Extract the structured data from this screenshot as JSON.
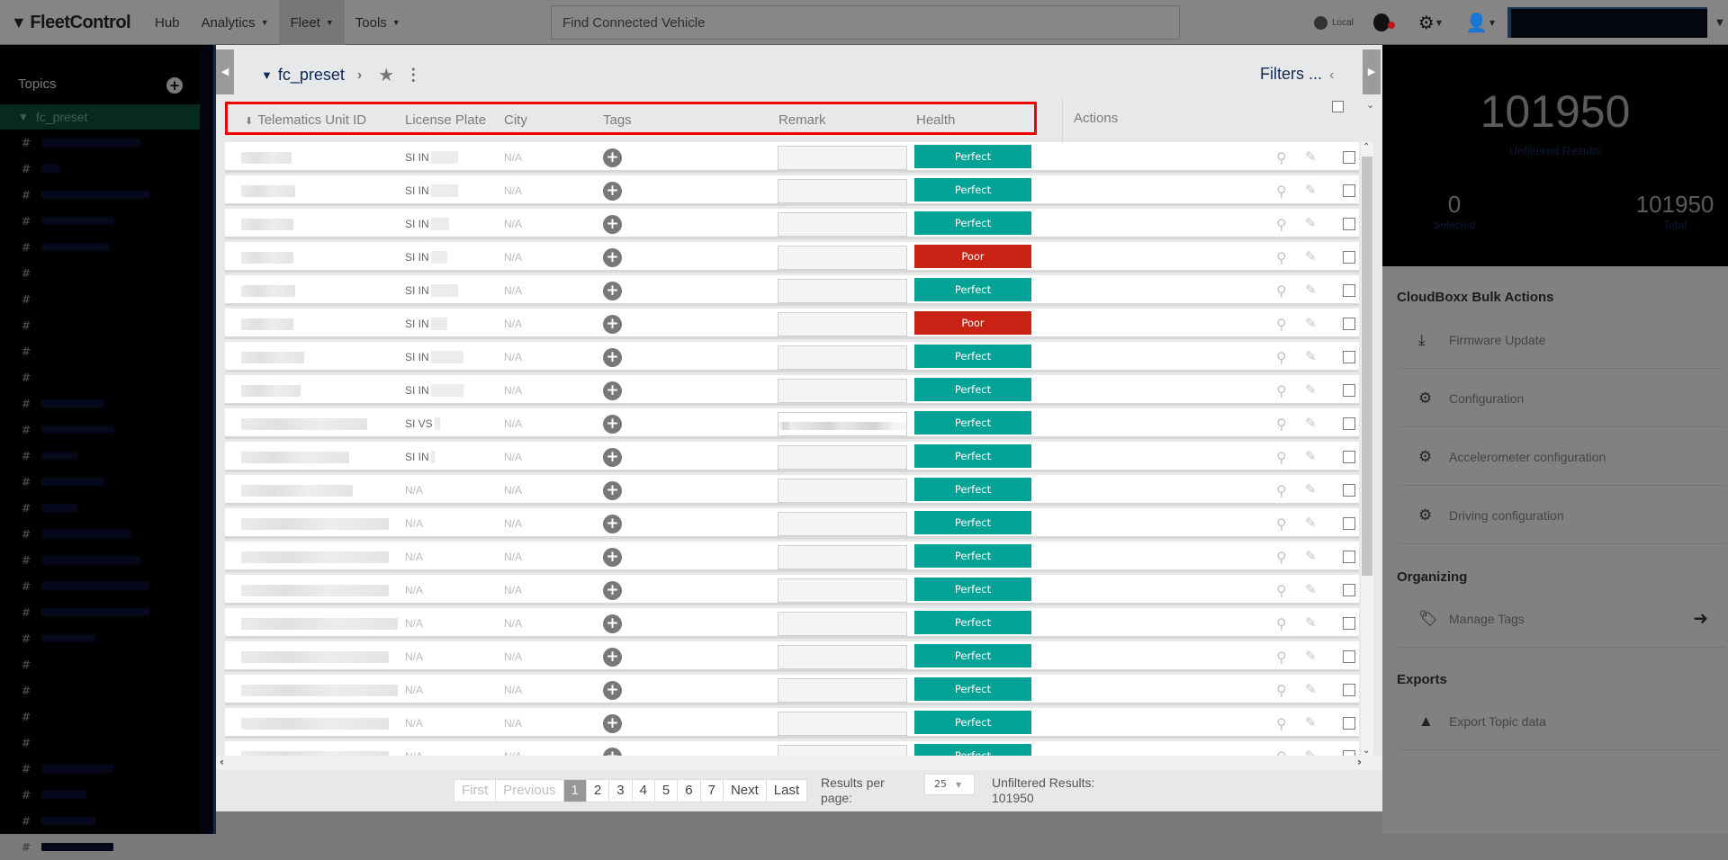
{
  "app": {
    "brand": "FleetControl"
  },
  "nav": {
    "items": [
      {
        "label": "Hub",
        "has_caret": false,
        "active": false
      },
      {
        "label": "Analytics",
        "has_caret": true,
        "active": false
      },
      {
        "label": "Fleet",
        "has_caret": true,
        "active": true
      },
      {
        "label": "Tools",
        "has_caret": true,
        "active": false
      }
    ]
  },
  "search": {
    "placeholder": "Find Connected Vehicle",
    "value": ""
  },
  "topright": {
    "locale_label": "Local"
  },
  "topics": {
    "title": "Topics",
    "active": "fc_preset",
    "items_count": 28
  },
  "breadcrumb": {
    "name": "fc_preset"
  },
  "filters_label": "Filters ...",
  "table": {
    "columns": [
      "Telematics Unit ID",
      "License Plate",
      "City",
      "Tags",
      "Remark",
      "Health"
    ],
    "actions_label": "Actions",
    "rows": [
      {
        "plate": "SI IN",
        "city": "N/A",
        "remark": "",
        "health": "Perfect"
      },
      {
        "plate": "SI IN",
        "city": "N/A",
        "remark": "",
        "health": "Perfect"
      },
      {
        "plate": "SI IN",
        "city": "N/A",
        "remark": "",
        "health": "Perfect"
      },
      {
        "plate": "SI IN",
        "city": "N/A",
        "remark": "",
        "health": "Poor"
      },
      {
        "plate": "SI IN",
        "city": "N/A",
        "remark": "",
        "health": "Perfect"
      },
      {
        "plate": "SI IN",
        "city": "N/A",
        "remark": "",
        "health": "Poor"
      },
      {
        "plate": "SI IN",
        "city": "N/A",
        "remark": "",
        "health": "Perfect"
      },
      {
        "plate": "SI IN",
        "city": "N/A",
        "remark": "",
        "health": "Perfect"
      },
      {
        "plate": "SI VS",
        "city": "N/A",
        "remark": "redacted",
        "health": "Perfect"
      },
      {
        "plate": "SI IN",
        "city": "N/A",
        "remark": "",
        "health": "Perfect"
      },
      {
        "plate": "N/A",
        "city": "N/A",
        "remark": "",
        "health": "Perfect"
      },
      {
        "plate": "N/A",
        "city": "N/A",
        "remark": "",
        "health": "Perfect"
      },
      {
        "plate": "N/A",
        "city": "N/A",
        "remark": "",
        "health": "Perfect"
      },
      {
        "plate": "N/A",
        "city": "N/A",
        "remark": "",
        "health": "Perfect"
      },
      {
        "plate": "N/A",
        "city": "N/A",
        "remark": "",
        "health": "Perfect"
      },
      {
        "plate": "N/A",
        "city": "N/A",
        "remark": "",
        "health": "Perfect"
      },
      {
        "plate": "N/A",
        "city": "N/A",
        "remark": "",
        "health": "Perfect"
      },
      {
        "plate": "N/A",
        "city": "N/A",
        "remark": "",
        "health": "Perfect"
      },
      {
        "plate": "N/A",
        "city": "N/A",
        "remark": "",
        "health": "Perfect"
      }
    ]
  },
  "health_colors": {
    "Perfect": "#00a396",
    "Poor": "#c92214"
  },
  "pagination": {
    "first": "First",
    "previous": "Previous",
    "pages": [
      "1",
      "2",
      "3",
      "4",
      "5",
      "6",
      "7"
    ],
    "current": "1",
    "next": "Next",
    "last": "Last",
    "results_per_page_label": "Results per page:",
    "results_per_page": "25",
    "unfiltered_label": "Unfiltered Results:",
    "unfiltered_value": "101950"
  },
  "stats": {
    "unfiltered": "101950",
    "unfiltered_label": "Unfiltered Results",
    "selected": "0",
    "selected_label": "Selected",
    "total": "101950",
    "total_label": "Total"
  },
  "bulk_actions": {
    "title": "CloudBoxx Bulk Actions",
    "items": [
      {
        "label": "Firmware Update",
        "icon": "download-icon"
      },
      {
        "label": "Configuration",
        "icon": "gear-icon"
      },
      {
        "label": "Accelerometer configuration",
        "icon": "gear-icon"
      },
      {
        "label": "Driving configuration",
        "icon": "gear-icon"
      }
    ]
  },
  "organizing": {
    "title": "Organizing",
    "items": [
      {
        "label": "Manage Tags",
        "icon": "tags-icon"
      }
    ]
  },
  "exports": {
    "title": "Exports",
    "items": [
      {
        "label": "Export Topic data",
        "icon": "export-icon"
      }
    ]
  }
}
